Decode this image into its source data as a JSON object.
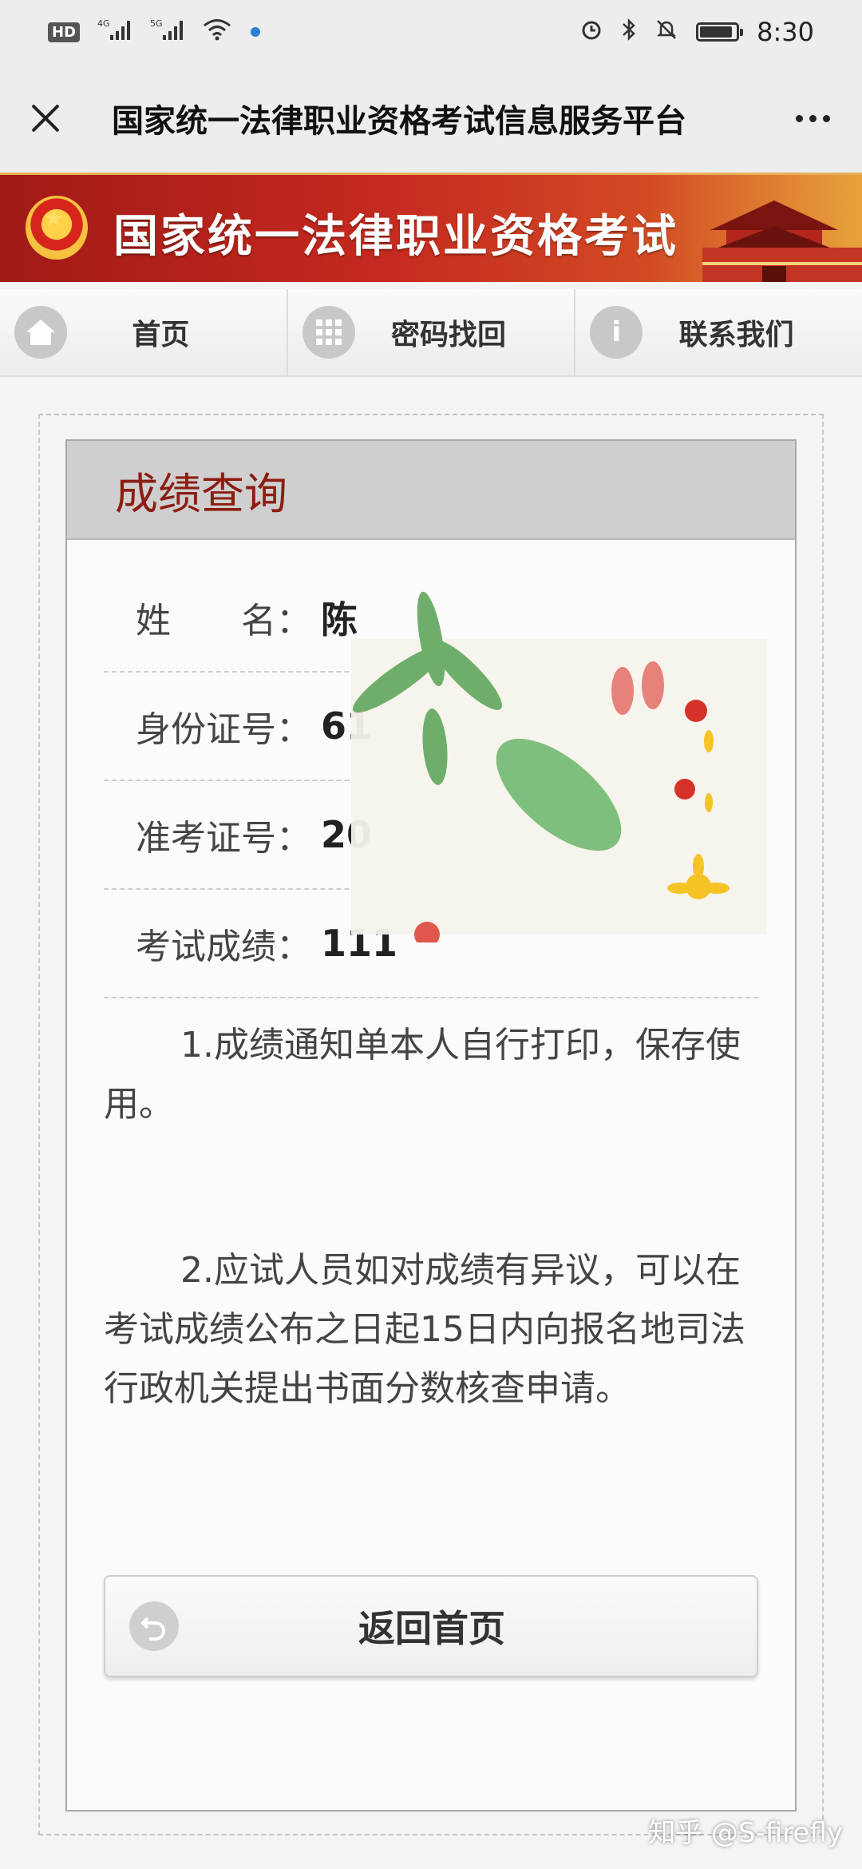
{
  "status_bar": {
    "hd": "HD",
    "network1": "4G",
    "network2": "5G",
    "time": "8:30",
    "battery_level": 0.92
  },
  "title_bar": {
    "title": "国家统一法律职业资格考试信息服务平台"
  },
  "banner": {
    "title": "国家统一法律职业资格考试"
  },
  "nav": {
    "items": [
      {
        "label": "首页",
        "icon": "home-icon"
      },
      {
        "label": "密码找回",
        "icon": "grid-icon"
      },
      {
        "label": "联系我们",
        "icon": "info-icon"
      }
    ]
  },
  "panel": {
    "title": "成绩查询",
    "rows": [
      {
        "label": "姓　　名：",
        "value": "陈"
      },
      {
        "label": "身份证号：",
        "value": "61"
      },
      {
        "label": "准考证号：",
        "value": "20"
      },
      {
        "label": "考试成绩：",
        "value": "111"
      }
    ],
    "notes": [
      "1.成绩通知单本人自行打印，保存使用。",
      "2.应试人员如对成绩有异议，可以在考试成绩公布之日起15日内向报名地司法行政机关提出书面分数核查申请。"
    ],
    "back_button": "返回首页"
  },
  "watermark": "知乎 @S-firefly",
  "colors": {
    "banner_red": "#c52a1f",
    "panel_title": "#8c1d12"
  }
}
